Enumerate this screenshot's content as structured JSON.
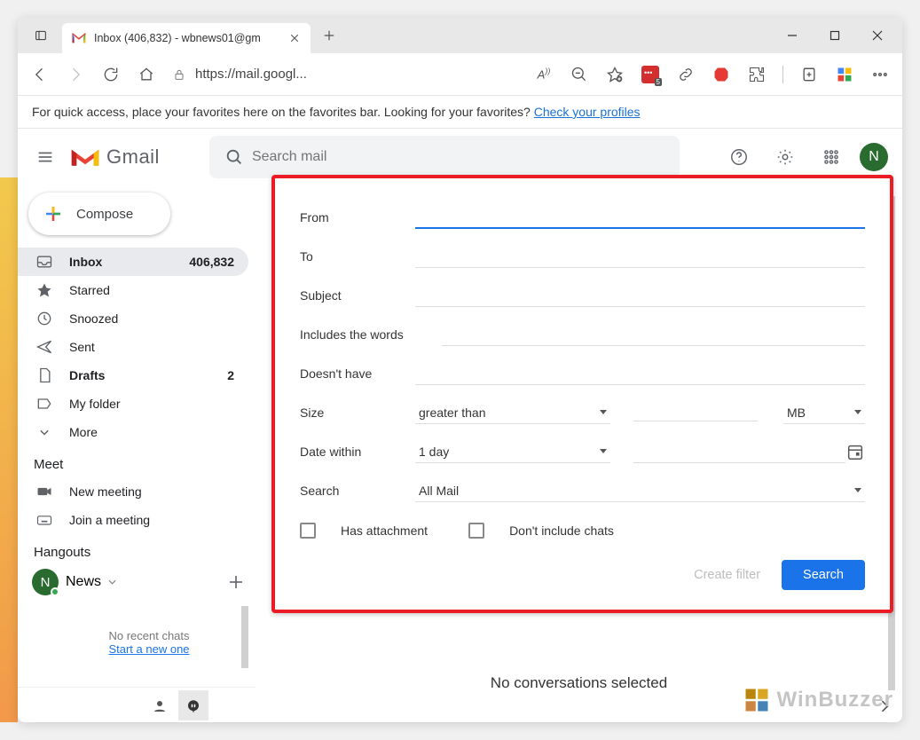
{
  "titlebar": {
    "tab_title": "Inbox (406,832) - wbnews01@gm"
  },
  "toolbar": {
    "url": "https://mail.googl..."
  },
  "favbar": {
    "text": "For quick access, place your favorites here on the favorites bar. Looking for your favorites?  ",
    "link": "Check your profiles"
  },
  "gmail": {
    "logo_text": "Gmail",
    "search_placeholder": "Search mail",
    "avatar_letter": "N"
  },
  "sidebar": {
    "compose": "Compose",
    "items": [
      {
        "label": "Inbox",
        "count": "406,832",
        "bold": true,
        "selected": true,
        "icon": "inbox"
      },
      {
        "label": "Starred",
        "count": "",
        "bold": false,
        "selected": false,
        "icon": "star"
      },
      {
        "label": "Snoozed",
        "count": "",
        "bold": false,
        "selected": false,
        "icon": "clock"
      },
      {
        "label": "Sent",
        "count": "",
        "bold": false,
        "selected": false,
        "icon": "send"
      },
      {
        "label": "Drafts",
        "count": "2",
        "bold": true,
        "selected": false,
        "icon": "file"
      },
      {
        "label": "My folder",
        "count": "",
        "bold": false,
        "selected": false,
        "icon": "label"
      },
      {
        "label": "More",
        "count": "",
        "bold": false,
        "selected": false,
        "icon": "chevron"
      }
    ],
    "meet_title": "Meet",
    "meet_items": [
      {
        "label": "New meeting",
        "icon": "camera"
      },
      {
        "label": "Join a meeting",
        "icon": "keyboard"
      }
    ],
    "hangouts_title": "Hangouts",
    "hangouts_name": "News",
    "chat_empty": "No recent chats",
    "chat_link": "Start a new one"
  },
  "main": {
    "no_conv": "No conversations selected"
  },
  "dropdown": {
    "from": "From",
    "to": "To",
    "subject": "Subject",
    "includes": "Includes the words",
    "doesnt": "Doesn't have",
    "size": "Size",
    "size_op": "greater than",
    "size_unit": "MB",
    "date": "Date within",
    "date_val": "1 day",
    "search": "Search",
    "search_val": "All Mail",
    "has_attach": "Has attachment",
    "no_chats": "Don't include chats",
    "create_filter": "Create filter",
    "search_btn": "Search"
  },
  "watermark": "WinBuzzer"
}
